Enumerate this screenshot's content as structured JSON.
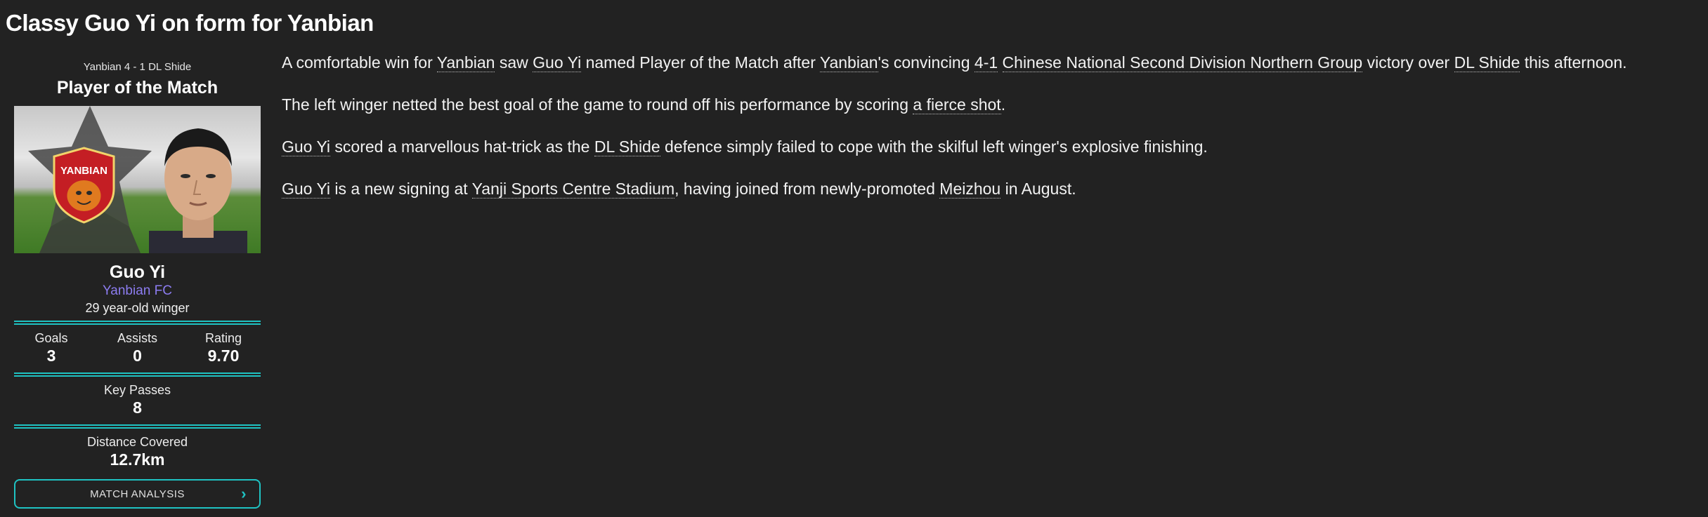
{
  "headline": "Classy Guo Yi on form for Yanbian",
  "card": {
    "score_line": "Yanbian 4 - 1 DL Shide",
    "title": "Player of the Match",
    "crest_text": "YANBIAN",
    "player_name": "Guo Yi",
    "club": "Yanbian FC",
    "description": "29 year-old winger",
    "stats": [
      {
        "label": "Goals",
        "value": "3"
      },
      {
        "label": "Assists",
        "value": "0"
      },
      {
        "label": "Rating",
        "value": "9.70"
      }
    ],
    "key_passes": {
      "label": "Key Passes",
      "value": "8"
    },
    "distance": {
      "label": "Distance Covered",
      "value": "12.7km"
    },
    "button_label": "MATCH ANALYSIS",
    "button_icon": "chevron-right-icon"
  },
  "article": {
    "p1": {
      "t1": "A comfortable win for ",
      "l1": "Yanbian",
      "t2": " saw ",
      "l2": "Guo Yi",
      "t3": " named Player of the Match after ",
      "l3": "Yanbian",
      "t4": "'s convincing ",
      "l4": "4-1",
      "t5": " ",
      "l5": "Chinese National Second Division Northern Group",
      "t6": " victory over ",
      "l6": "DL Shide",
      "t7": " this afternoon."
    },
    "p2": {
      "t1": "The left winger netted the best goal of the game to round off his performance by scoring ",
      "l1": "a fierce shot",
      "t2": "."
    },
    "p3": {
      "l1": "Guo Yi",
      "t1": " scored a marvellous hat-trick as the ",
      "l2": "DL Shide",
      "t2": " defence simply failed to cope with the skilful left winger's explosive finishing."
    },
    "p4": {
      "l1": "Guo Yi",
      "t1": " is a new signing at ",
      "l2": "Yanji Sports Centre Stadium",
      "t2": ", having joined from newly-promoted ",
      "l3": "Meizhou",
      "t3": " in August."
    }
  },
  "colors": {
    "background": "#222222",
    "accent": "#1fc3c3",
    "club": "#8c7cf0"
  }
}
